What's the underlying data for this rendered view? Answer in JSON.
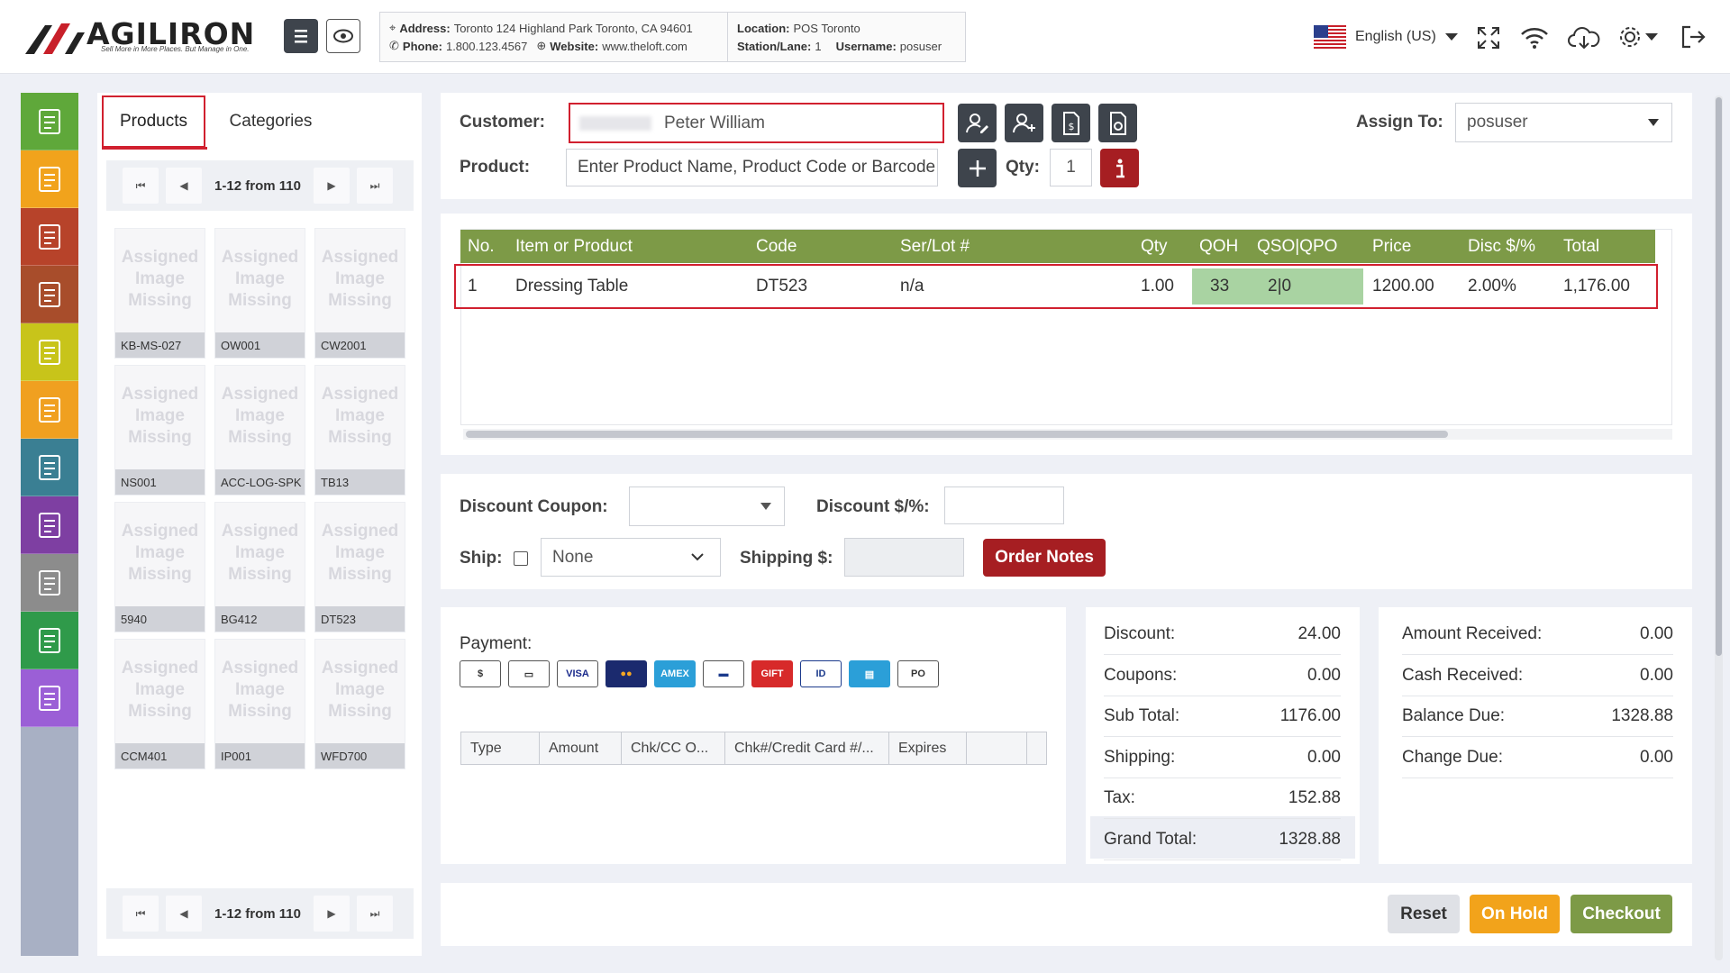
{
  "header": {
    "brand": "AGILIRON",
    "tagline": "Sell More in More Places. But Manage in One.",
    "info": {
      "address_label": "Address:",
      "address": "Toronto 124 Highland Park Toronto, CA 94601",
      "phone_label": "Phone:",
      "phone": "1.800.123.4567",
      "website_label": "Website:",
      "website": "www.theloft.com",
      "location_label": "Location:",
      "location": "POS Toronto",
      "station_label": "Station/Lane:",
      "station": "1",
      "username_label": "Username:",
      "username": "posuser"
    },
    "language": "English (US)"
  },
  "sidebar_icons": [
    {
      "icon": "pos-register-icon",
      "color": "#5fa83a"
    },
    {
      "icon": "cancel-sale-icon",
      "color": "#f1a31c"
    },
    {
      "icon": "returns-icon",
      "color": "#b7432a"
    },
    {
      "icon": "exchange-icon",
      "color": "#a84d2b"
    },
    {
      "icon": "loyalty-icon",
      "color": "#c8c41a"
    },
    {
      "icon": "gift-card-icon",
      "color": "#f0a020"
    },
    {
      "icon": "cash-drawer-icon",
      "color": "#3a7f93"
    },
    {
      "icon": "reports-icon",
      "color": "#7e3fa2"
    },
    {
      "icon": "documents-icon",
      "color": "#8c8c8c"
    },
    {
      "icon": "payout-icon",
      "color": "#2f9a4a"
    },
    {
      "icon": "calculator-icon",
      "color": "#9b5fd6"
    }
  ],
  "catalog": {
    "tabs": [
      "Products",
      "Categories"
    ],
    "pager_text": "1-12 from 110",
    "missing_image_text": "Assigned Image Missing",
    "products": [
      "KB-MS-027",
      "OW001",
      "CW2001",
      "NS001",
      "ACC-LOG-SPK",
      "TB13",
      "5940",
      "BG412",
      "DT523",
      "CCM401",
      "IP001",
      "WFD700"
    ]
  },
  "order": {
    "customer_label": "Customer:",
    "customer_value": "Peter  William",
    "product_label": "Product:",
    "product_placeholder": "Enter Product Name, Product Code or Barcode",
    "qty_label": "Qty:",
    "qty_value": "1",
    "assign_label": "Assign To:",
    "assign_value": "posuser",
    "columns": [
      "No.",
      "Item or Product",
      "Code",
      "Ser/Lot #",
      "Qty",
      "QOH",
      "QSO|QPO",
      "Price",
      "Disc $/%",
      "Total"
    ],
    "lines": [
      {
        "no": "1",
        "item": "Dressing Table",
        "code": "DT523",
        "serlot": "n/a",
        "qty": "1.00",
        "qoh": "33",
        "qsoqpo": "2|0",
        "price": "1200.00",
        "disc": "2.00%",
        "total": "1,176.00"
      }
    ]
  },
  "extras": {
    "coupon_label": "Discount Coupon:",
    "discount_label": "Discount $/%:",
    "ship_label": "Ship:",
    "ship_value": "None",
    "shipping_label": "Shipping $:",
    "order_notes": "Order Notes"
  },
  "payment": {
    "label": "Payment:",
    "methods": [
      "cash",
      "check",
      "VISA",
      "MasterCard",
      "AMEX",
      "credit-card",
      "GIFT",
      "id-card",
      "debit",
      "PO"
    ],
    "columns": [
      "Type",
      "Amount",
      "Chk/CC O...",
      "Chk#/Credit Card #/...",
      "Expires",
      ""
    ]
  },
  "totals": [
    {
      "label": "Discount:",
      "value": "24.00"
    },
    {
      "label": "Coupons:",
      "value": "0.00"
    },
    {
      "label": "Sub Total:",
      "value": "1176.00"
    },
    {
      "label": "Shipping:",
      "value": "0.00"
    },
    {
      "label": "Tax:",
      "value": "152.88"
    },
    {
      "label": "Grand Total:",
      "value": "1328.88"
    }
  ],
  "received": [
    {
      "label": "Amount Received:",
      "value": "0.00"
    },
    {
      "label": "Cash Received:",
      "value": "0.00"
    },
    {
      "label": "Balance Due:",
      "value": "1328.88"
    },
    {
      "label": "Change Due:",
      "value": "0.00"
    }
  ],
  "actions": {
    "reset": "Reset",
    "on_hold": "On Hold",
    "checkout": "Checkout"
  },
  "colors": {
    "accent_green": "#7d9a47",
    "danger_red": "#a61e22",
    "highlight": "#d1202f",
    "hold_orange": "#f2a31b"
  }
}
